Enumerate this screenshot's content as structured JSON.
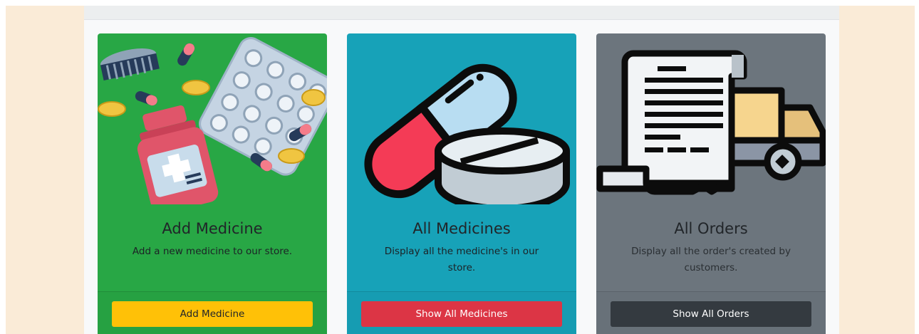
{
  "cards": [
    {
      "id": "add-medicine",
      "title": "Add Medicine",
      "text": "Add a new medicine to our store.",
      "button_label": "Add Medicine",
      "background": "#28a745",
      "button_color": "#ffc107",
      "icon": "medicines-illustration"
    },
    {
      "id": "all-medicines",
      "title": "All Medicines",
      "text": "Display all the medicine's in our store.",
      "button_label": "Show All Medicines",
      "background": "#17a2b8",
      "button_color": "#dc3545",
      "icon": "capsule-pill-icon"
    },
    {
      "id": "all-orders",
      "title": "All Orders",
      "text": "Display all the order's created by customers.",
      "button_label": "Show All Orders",
      "background": "#6c757d",
      "button_color": "#343a40",
      "icon": "invoice-delivery-truck-icon"
    }
  ]
}
